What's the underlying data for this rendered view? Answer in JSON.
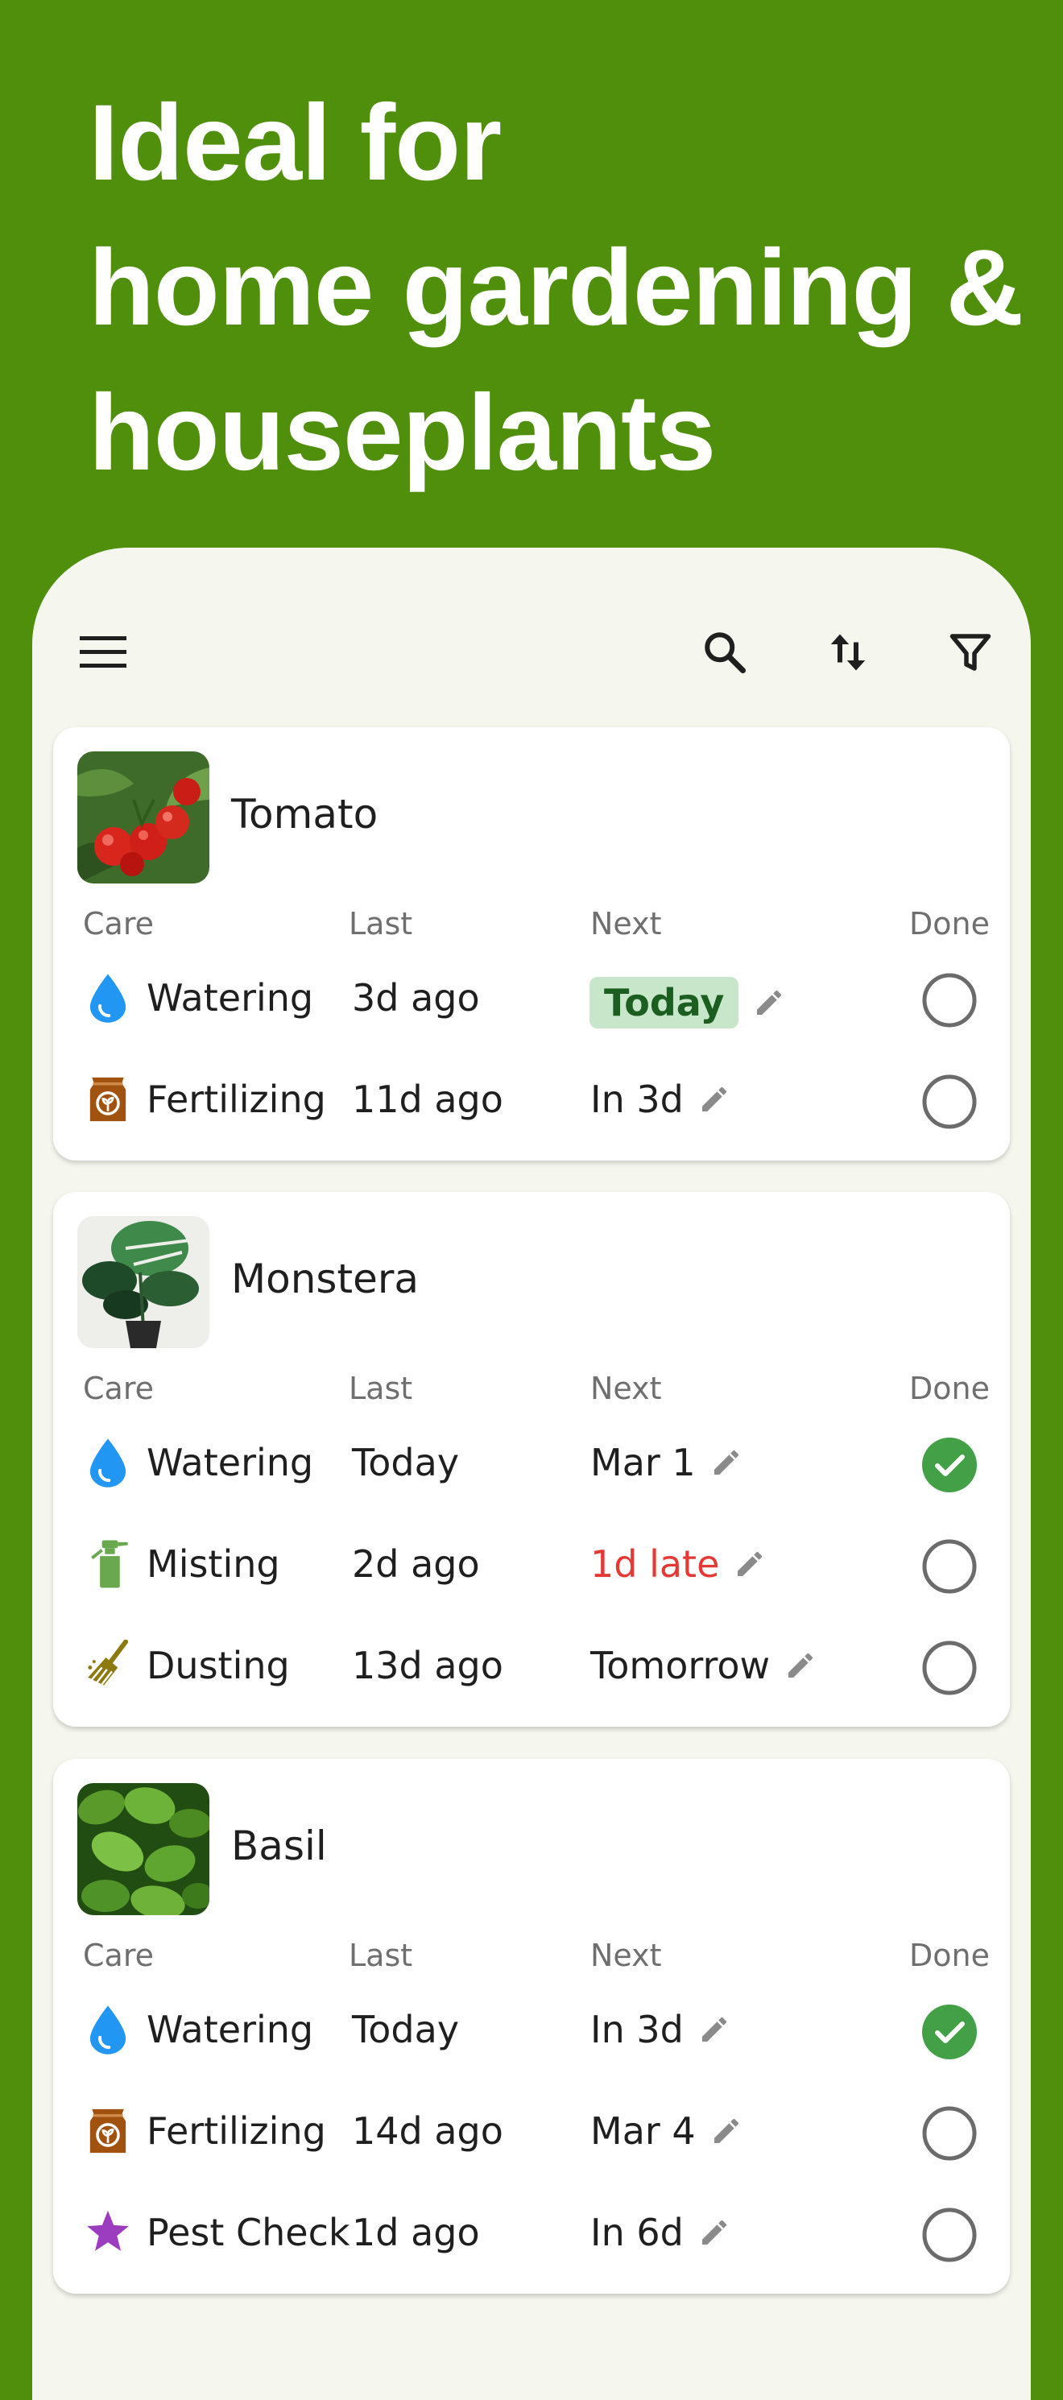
{
  "headline": {
    "line1": "Ideal for",
    "line2": "home gardening &",
    "line3": "houseplants"
  },
  "toolbar": {
    "menu_icon": "menu-icon",
    "search_icon": "search-icon",
    "sort_icon": "sort-icon",
    "filter_icon": "filter-icon"
  },
  "columns": {
    "care": "Care",
    "last": "Last",
    "next": "Next",
    "done": "Done"
  },
  "colors": {
    "banner": "#4f8f0b",
    "water": "#2196f3",
    "fertilize": "#a1520f",
    "mist": "#6aa84f",
    "dust": "#8d7a0e",
    "pest": "#9c3dbf",
    "done": "#43a047",
    "late": "#e53935",
    "today_bg": "#c8e6c9"
  },
  "plants": [
    {
      "name": "Tomato",
      "tasks": [
        {
          "care": "Watering",
          "icon": "water-drop-icon",
          "last": "3d ago",
          "next": "Today",
          "status": "today",
          "done": false
        },
        {
          "care": "Fertilizing",
          "icon": "fertilizer-bag-icon",
          "last": "11d ago",
          "next": "In 3d",
          "status": "normal",
          "done": false
        }
      ]
    },
    {
      "name": "Monstera",
      "tasks": [
        {
          "care": "Watering",
          "icon": "water-drop-icon",
          "last": "Today",
          "next": "Mar 1",
          "status": "normal",
          "done": true
        },
        {
          "care": "Misting",
          "icon": "spray-bottle-icon",
          "last": "2d ago",
          "next": "1d late",
          "status": "late",
          "done": false
        },
        {
          "care": "Dusting",
          "icon": "broom-icon",
          "last": "13d ago",
          "next": "Tomorrow",
          "status": "normal",
          "done": false
        }
      ]
    },
    {
      "name": "Basil",
      "tasks": [
        {
          "care": "Watering",
          "icon": "water-drop-icon",
          "last": "Today",
          "next": "In 3d",
          "status": "normal",
          "done": true
        },
        {
          "care": "Fertilizing",
          "icon": "fertilizer-bag-icon",
          "last": "14d ago",
          "next": "Mar 4",
          "status": "normal",
          "done": false
        },
        {
          "care": "Pest Check",
          "icon": "star-icon",
          "last": "1d ago",
          "next": "In 6d",
          "status": "normal",
          "done": false
        }
      ]
    }
  ]
}
